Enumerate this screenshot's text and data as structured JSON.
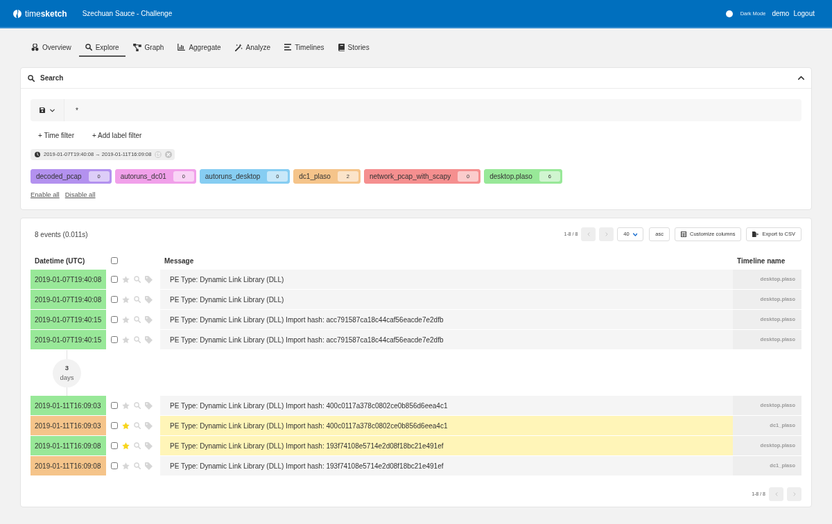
{
  "app": {
    "logo": "time**sketch**",
    "sketch_title": "Szechuan Sauce - Challenge",
    "dark_mode_label": "Dark Mode",
    "user": "demo",
    "logout": "Logout"
  },
  "tabs": [
    {
      "label": "Overview",
      "selected": false
    },
    {
      "label": "Explore",
      "selected": true
    },
    {
      "label": "Graph",
      "selected": false
    },
    {
      "label": "Aggregate",
      "selected": false
    },
    {
      "label": "Analyze",
      "selected": false
    },
    {
      "label": "Timelines",
      "selected": false
    },
    {
      "label": "Stories",
      "selected": false
    }
  ],
  "search": {
    "title": "Search",
    "query": "*",
    "filters": [
      "+ Time filter",
      "+ Add label filter"
    ],
    "time_range": "2019-01-07T19:40:08 → 2019-01-11T16:09:08",
    "timelines": [
      {
        "name": "decoded_pcap",
        "count": "0",
        "color": "#b391ef"
      },
      {
        "name": "autoruns_dc01",
        "count": "0",
        "color": "#f1a0ea"
      },
      {
        "name": "autoruns_desktop",
        "count": "0",
        "color": "#86cdf2"
      },
      {
        "name": "dc1_plaso",
        "count": "2",
        "color": "#f5c48a"
      },
      {
        "name": "network_pcap_with_scapy",
        "count": "0",
        "color": "#f58f8f"
      },
      {
        "name": "desktop.plaso",
        "count": "6",
        "color": "#98e898"
      }
    ],
    "enable_all": "Enable all",
    "disable_all": "Disable all"
  },
  "events": {
    "summary": "8 events (0.011s)",
    "pager": {
      "range": "1-8 / 8",
      "prev_disabled": true,
      "next_disabled": true
    },
    "page_size": "40",
    "order": "asc",
    "buttons": [
      "Customize columns",
      "Export to CSV"
    ],
    "columns": [
      "Datetime (UTC)",
      "Message",
      "Timeline name"
    ],
    "select_all_checked": false,
    "rows": [
      {
        "kind": "event",
        "datetime": "2019-01-07T19:40:08",
        "message": "PE Type: Dynamic Link Library (DLL)",
        "timeline": "desktop.plaso",
        "color": "#98e898",
        "checked": false,
        "starred": false
      },
      {
        "kind": "event",
        "datetime": "2019-01-07T19:40:08",
        "message": "PE Type: Dynamic Link Library (DLL)",
        "timeline": "desktop.plaso",
        "color": "#98e898",
        "checked": false,
        "starred": false
      },
      {
        "kind": "event",
        "datetime": "2019-01-07T19:40:15",
        "message": "PE Type: Dynamic Link Library (DLL) Import hash: acc791587ca18c44caf56eacde7e2dfb",
        "timeline": "desktop.plaso",
        "color": "#98e898",
        "checked": false,
        "starred": false
      },
      {
        "kind": "event",
        "datetime": "2019-01-07T19:40:15",
        "message": "PE Type: Dynamic Link Library (DLL) Import hash: acc791587ca18c44caf56eacde7e2dfb",
        "timeline": "desktop.plaso",
        "color": "#98e898",
        "checked": false,
        "starred": false
      },
      {
        "kind": "gap",
        "amount": "3",
        "unit": "days"
      },
      {
        "kind": "event",
        "datetime": "2019-01-11T16:09:03",
        "message": "PE Type: Dynamic Link Library (DLL) Import hash: 400c0117a378c0802ce0b856d6eea4c1",
        "timeline": "desktop.plaso",
        "color": "#98e898",
        "checked": false,
        "starred": false
      },
      {
        "kind": "event",
        "datetime": "2019-01-11T16:09:03",
        "message": "PE Type: Dynamic Link Library (DLL) Import hash: 400c0117a378c0802ce0b856d6eea4c1",
        "timeline": "dc1_plaso",
        "color": "#f5c48a",
        "checked": false,
        "starred": true
      },
      {
        "kind": "event",
        "datetime": "2019-01-11T16:09:08",
        "message": "PE Type: Dynamic Link Library (DLL) Import hash: 193f74108e5714e2d08f18bc21e491ef",
        "timeline": "desktop.plaso",
        "color": "#98e898",
        "checked": false,
        "starred": true
      },
      {
        "kind": "event",
        "datetime": "2019-01-11T16:09:08",
        "message": "PE Type: Dynamic Link Library (DLL) Import hash: 193f74108e5714e2d08f18bc21e491ef",
        "timeline": "dc1_plaso",
        "color": "#f5c48a",
        "checked": false,
        "starred": false
      }
    ],
    "bottom_pager": {
      "range": "1-8 / 8",
      "prev_disabled": true,
      "next_disabled": true
    }
  }
}
